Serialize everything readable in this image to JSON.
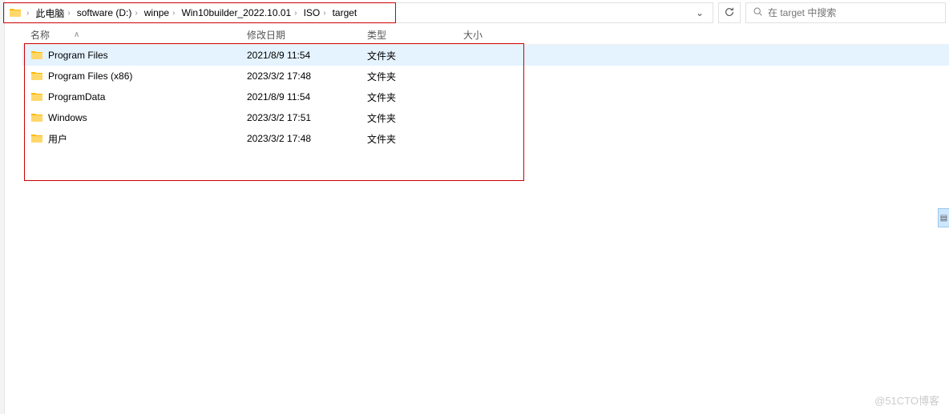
{
  "breadcrumb": {
    "items": [
      {
        "label": "此电脑"
      },
      {
        "label": "software (D:)"
      },
      {
        "label": "winpe"
      },
      {
        "label": "Win10builder_2022.10.01"
      },
      {
        "label": "ISO"
      },
      {
        "label": "target"
      }
    ]
  },
  "search": {
    "placeholder": "在 target 中搜索"
  },
  "columns": {
    "name": "名称",
    "date": "修改日期",
    "type": "类型",
    "size": "大小"
  },
  "rows": [
    {
      "name": "Program Files",
      "date": "2021/8/9 11:54",
      "type": "文件夹",
      "size": ""
    },
    {
      "name": "Program Files (x86)",
      "date": "2023/3/2 17:48",
      "type": "文件夹",
      "size": ""
    },
    {
      "name": "ProgramData",
      "date": "2021/8/9 11:54",
      "type": "文件夹",
      "size": ""
    },
    {
      "name": "Windows",
      "date": "2023/3/2 17:51",
      "type": "文件夹",
      "size": ""
    },
    {
      "name": "用户",
      "date": "2023/3/2 17:48",
      "type": "文件夹",
      "size": ""
    }
  ],
  "watermark": "@51CTO博客"
}
